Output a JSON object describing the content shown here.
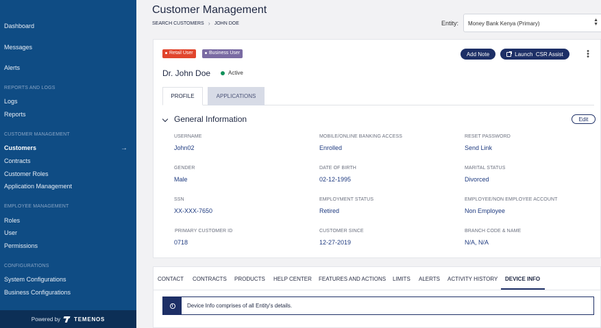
{
  "sidebar": {
    "items": {
      "dashboard": "Dashboard",
      "messages": "Messages",
      "alerts": "Alerts",
      "logs": "Logs",
      "reports": "Reports",
      "customers": "Customers",
      "contracts": "Contracts",
      "customer_roles": "Customer Roles",
      "application_management": "Application Management",
      "roles": "Roles",
      "user": "User",
      "permissions": "Permissions",
      "system_configurations": "System Configurations",
      "business_configurations": "Business Configurations"
    },
    "sections": {
      "reports_logs": "REPORTS AND LOGS",
      "customer_management": "CUSTOMER MANAGEMENT",
      "employee_management": "EMPLOYEE MANAGEMENT",
      "configurations": "CONFIGURATIONS"
    },
    "active_item": "Customers",
    "footer": {
      "powered_by": "Powered by",
      "brand": "TEMENOS"
    }
  },
  "header": {
    "title": "Customer Management",
    "breadcrumb": [
      "SEARCH CUSTOMERS",
      "JOHN DOE"
    ],
    "entity_label": "Entity:",
    "entity_value": "Money Bank Kenya (Primary)"
  },
  "customer": {
    "badges": [
      "Retail User",
      "Business User"
    ],
    "name": "Dr. John Doe",
    "status": "Active",
    "actions": {
      "add_note": "Add Note",
      "launch_csr": "Launch  CSR Assist"
    }
  },
  "profile_tabs": [
    "PROFILE",
    "APPLICATIONS"
  ],
  "general_information": {
    "title": "General Information",
    "edit_label": "Edit",
    "fields": [
      {
        "label": "USERNAME",
        "value": "John02"
      },
      {
        "label": "MOBILE/ONLINE BANKING ACCESS",
        "value": "Enrolled"
      },
      {
        "label": "RESET PASSWORD",
        "value": "Send Link"
      },
      {
        "label": "GENDER",
        "value": "Male"
      },
      {
        "label": "DATE OF BIRTH",
        "value": "02-12-1995"
      },
      {
        "label": "MARITAL STATUS",
        "value": "Divorced"
      },
      {
        "label": "SSN",
        "value": "XX-XXX-7650"
      },
      {
        "label": "EMPLOYMENT STATUS",
        "value": "Retired"
      },
      {
        "label": "EMPLOYEE/NON EMPLOYEE ACCOUNT",
        "value": "Non Employee"
      },
      {
        "label": "PRIMARY CUSTOMER ID",
        "value": "0718"
      },
      {
        "label": "CUSTOMER SINCE",
        "value": "12-27-2019"
      },
      {
        "label": "BRANCH CODE & NAME",
        "value": "N/A, N/A"
      }
    ]
  },
  "detail_tabs": [
    "CONTACT",
    "CONTRACTS",
    "PRODUCTS",
    "HELP CENTER",
    "FEATURES AND ACTIONS",
    "LIMITS",
    "ALERTS",
    "ACTIVITY HISTORY",
    "DEVICE INFO"
  ],
  "active_detail_tab": "DEVICE INFO",
  "device_info": {
    "message": "Device Info comprises of all Entity's details."
  },
  "colors": {
    "sidebar_bg": "#0f4c84",
    "primary_button": "#1d2f66",
    "retail_badge": "#e1452d",
    "business_badge": "#7a6ba3",
    "active_status": "#12915a"
  }
}
